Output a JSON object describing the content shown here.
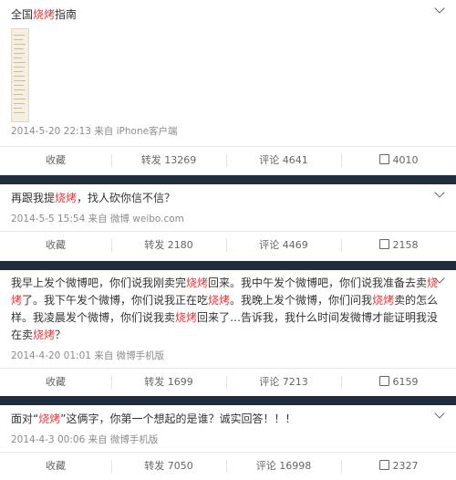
{
  "keyword": "烧烤",
  "actions": {
    "collect": "收藏",
    "repost_prefix": "转发",
    "comment_prefix": "评论"
  },
  "posts": [
    {
      "segments": [
        "全国",
        "烧烤",
        "指南"
      ],
      "meta": "2014-5-20 22:13 来自 iPhone客户端",
      "repost": "13269",
      "comment": "4641",
      "like": "4010",
      "has_image": true
    },
    {
      "segments": [
        "再跟我提",
        "烧烤",
        "，找人砍你信不信？"
      ],
      "meta": "2014-5-5 15:54 来自 微博 weibo.com",
      "repost": "2180",
      "comment": "4469",
      "like": "2158"
    },
    {
      "lines": [
        [
          "我早上发个微博吧，你们说我刚卖完",
          "烧烤",
          "回来。我中午发个微博吧，你们说我准备去卖",
          "烧"
        ],
        [
          "烤",
          "了。我下午发个微博，你们说我正在吃",
          "烧烤",
          "。我晚上发个微博，你们问我",
          "烧烤",
          "卖的怎么"
        ],
        [
          "样。我凌晨发个微博，你们说我卖",
          "烧烤",
          "回来了…告诉我，我什么时间发微博才能证明我没"
        ],
        [
          "在卖",
          "烧烤",
          "？"
        ]
      ],
      "meta": "2014-4-20 01:01 来自 微博手机版",
      "repost": "1699",
      "comment": "7213",
      "like": "6159"
    },
    {
      "segments": [
        "面对“",
        "烧烤",
        "”这俩字，你第一个想起的是谁？诚实回答！！！"
      ],
      "meta": "2014-4-3 00:06 来自 微博手机版",
      "repost": "7050",
      "comment": "16998",
      "like": "2327"
    }
  ]
}
